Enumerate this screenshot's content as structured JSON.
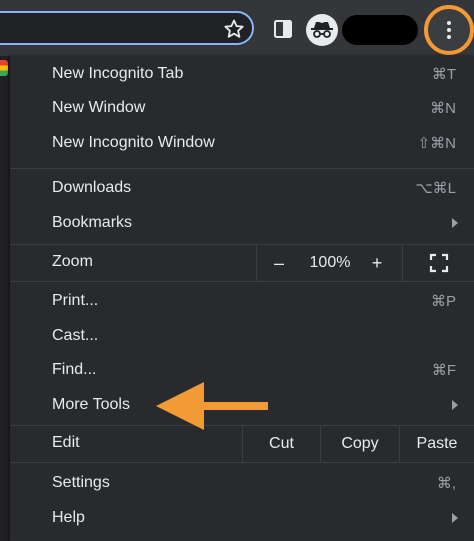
{
  "toolbar": {
    "icons": [
      "star-icon",
      "side-panel-icon",
      "incognito-icon",
      "profile-chip",
      "more-vert-icon"
    ],
    "highlight_color": "#f29a35"
  },
  "menu": {
    "new_incognito_tab": {
      "label": "New Incognito Tab",
      "shortcut": "⌘T"
    },
    "new_window": {
      "label": "New Window",
      "shortcut": "⌘N"
    },
    "new_incognito_window": {
      "label": "New Incognito Window",
      "shortcut": "⇧⌘N"
    },
    "downloads": {
      "label": "Downloads",
      "shortcut": "⌥⌘L"
    },
    "bookmarks": {
      "label": "Bookmarks"
    },
    "zoom": {
      "label": "Zoom",
      "minus": "–",
      "value": "100%",
      "plus": "+"
    },
    "print": {
      "label": "Print...",
      "shortcut": "⌘P"
    },
    "cast": {
      "label": "Cast..."
    },
    "find": {
      "label": "Find...",
      "shortcut": "⌘F"
    },
    "more_tools": {
      "label": "More Tools"
    },
    "edit": {
      "label": "Edit",
      "cut": "Cut",
      "copy": "Copy",
      "paste": "Paste"
    },
    "settings": {
      "label": "Settings",
      "shortcut": "⌘,"
    },
    "help": {
      "label": "Help"
    }
  },
  "annotation": {
    "arrow_color": "#f29a35",
    "points_to": "More Tools"
  }
}
